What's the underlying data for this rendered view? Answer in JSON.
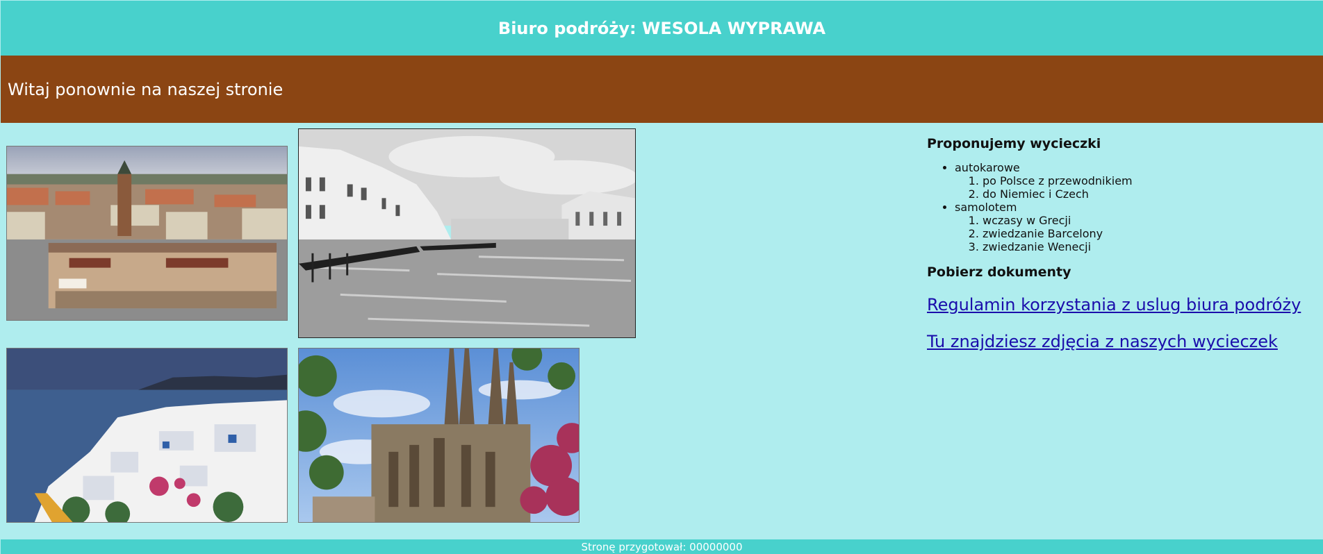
{
  "header": {
    "title": "Biuro podróży: WESOLA WYPRAWA"
  },
  "banner": {
    "text": "Witaj ponownie na naszej stronie"
  },
  "gallery": {
    "photos": [
      {
        "subject": "krakow-market-square"
      },
      {
        "subject": "venice-grand-canal-bw"
      },
      {
        "subject": "santorini-cliffs"
      },
      {
        "subject": "barcelona-sagrada-familia"
      }
    ]
  },
  "offers": {
    "heading": "Proponujemy wycieczki",
    "groups": [
      {
        "label": "autokarowe",
        "items": [
          "po Polsce z przewodnikiem",
          "do Niemiec i Czech"
        ]
      },
      {
        "label": "samolotem",
        "items": [
          "wczasy w Grecji",
          "zwiedzanie Barcelony",
          "zwiedzanie Wenecji"
        ]
      }
    ]
  },
  "documents": {
    "heading": "Pobierz dokumenty",
    "links": [
      "Regulamin korzystania z uslug biura podróży",
      "Tu znajdziesz zdjęcia z naszych wycieczek"
    ]
  },
  "footer": {
    "text": "Stronę przygotował: 00000000"
  },
  "colors": {
    "header_bg": "#48d1cc",
    "banner_bg": "#8b4513",
    "page_bg": "#afedee",
    "link": "#1a0dab"
  }
}
